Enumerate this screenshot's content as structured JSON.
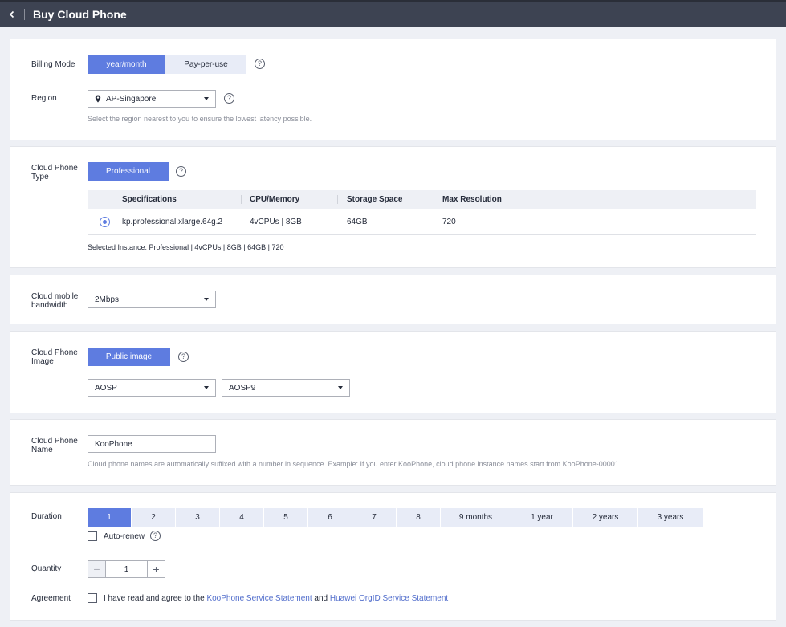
{
  "header": {
    "title": "Buy Cloud Phone"
  },
  "billing": {
    "label": "Billing Mode",
    "options": [
      "year/month",
      "Pay-per-use"
    ],
    "selected": 0
  },
  "region": {
    "label": "Region",
    "value": "AP-Singapore",
    "hint": "Select the region nearest to you to ensure the lowest latency possible."
  },
  "phone_type": {
    "label": "Cloud Phone Type",
    "chip": "Professional",
    "columns": [
      "Specifications",
      "CPU/Memory",
      "Storage Space",
      "Max Resolution"
    ],
    "rows": [
      {
        "spec": "kp.professional.xlarge.64g.2",
        "cpu": "4vCPUs | 8GB",
        "storage": "64GB",
        "resolution": "720"
      }
    ],
    "summary": "Selected Instance: Professional | 4vCPUs | 8GB | 64GB | 720"
  },
  "bandwidth": {
    "label": "Cloud mobile bandwidth",
    "value": "2Mbps"
  },
  "image": {
    "label": "Cloud Phone Image",
    "chip": "Public image",
    "os": "AOSP",
    "version": "AOSP9"
  },
  "name": {
    "label": "Cloud Phone Name",
    "value": "KooPhone",
    "hint": "Cloud phone names are automatically suffixed with a number in sequence. Example: If you enter KooPhone, cloud phone instance names start from KooPhone-00001."
  },
  "duration": {
    "label": "Duration",
    "options": [
      "1",
      "2",
      "3",
      "4",
      "5",
      "6",
      "7",
      "8",
      "9 months",
      "1 year",
      "2 years",
      "3 years"
    ],
    "selected": 0,
    "auto_renew": "Auto-renew"
  },
  "quantity": {
    "label": "Quantity",
    "value": "1"
  },
  "agreement": {
    "label": "Agreement",
    "prefix": "I have read and agree to the",
    "link1": "KooPhone Service Statement",
    "and": "and",
    "link2": "Huawei OrgID Service Statement"
  },
  "colors": {
    "primary": "#5e7ce0",
    "topbar": "#3d4352",
    "link": "#526ecc"
  },
  "icons": [
    "chevron-left-icon",
    "help-icon",
    "location-pin-icon",
    "caret-down-icon",
    "minus-icon",
    "plus-icon"
  ]
}
